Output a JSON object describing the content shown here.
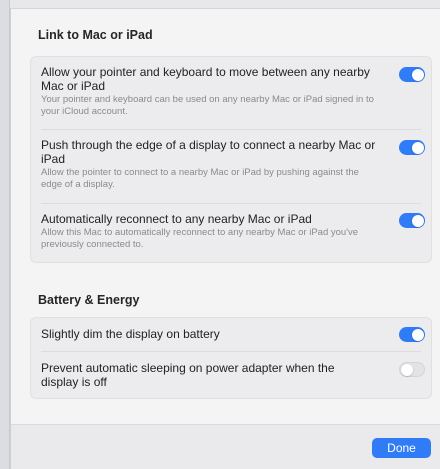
{
  "sections": [
    {
      "title": "Link to Mac or iPad",
      "items": [
        {
          "title": "Allow your pointer and keyboard to move between any nearby Mac or iPad",
          "description": "Your pointer and keyboard can be used on any nearby Mac or iPad signed in to your iCloud account.",
          "enabled": true
        },
        {
          "title": "Push through the edge of a display to connect a nearby Mac or iPad",
          "description": "Allow the pointer to connect to a nearby Mac or iPad by pushing against the edge of a display.",
          "enabled": true
        },
        {
          "title": "Automatically reconnect to any nearby Mac or iPad",
          "description": "Allow this Mac to automatically reconnect to any nearby Mac or iPad you've previously connected to.",
          "enabled": true
        }
      ]
    },
    {
      "title": "Battery & Energy",
      "items": [
        {
          "title": "Slightly dim the display on battery",
          "enabled": true
        },
        {
          "title": "Prevent automatic sleeping on power adapter when the display is off",
          "enabled": false
        }
      ]
    }
  ],
  "footer": {
    "done_label": "Done"
  },
  "colors": {
    "accent": "#2f7cf6",
    "toggle_off": "#e3e3e6"
  }
}
